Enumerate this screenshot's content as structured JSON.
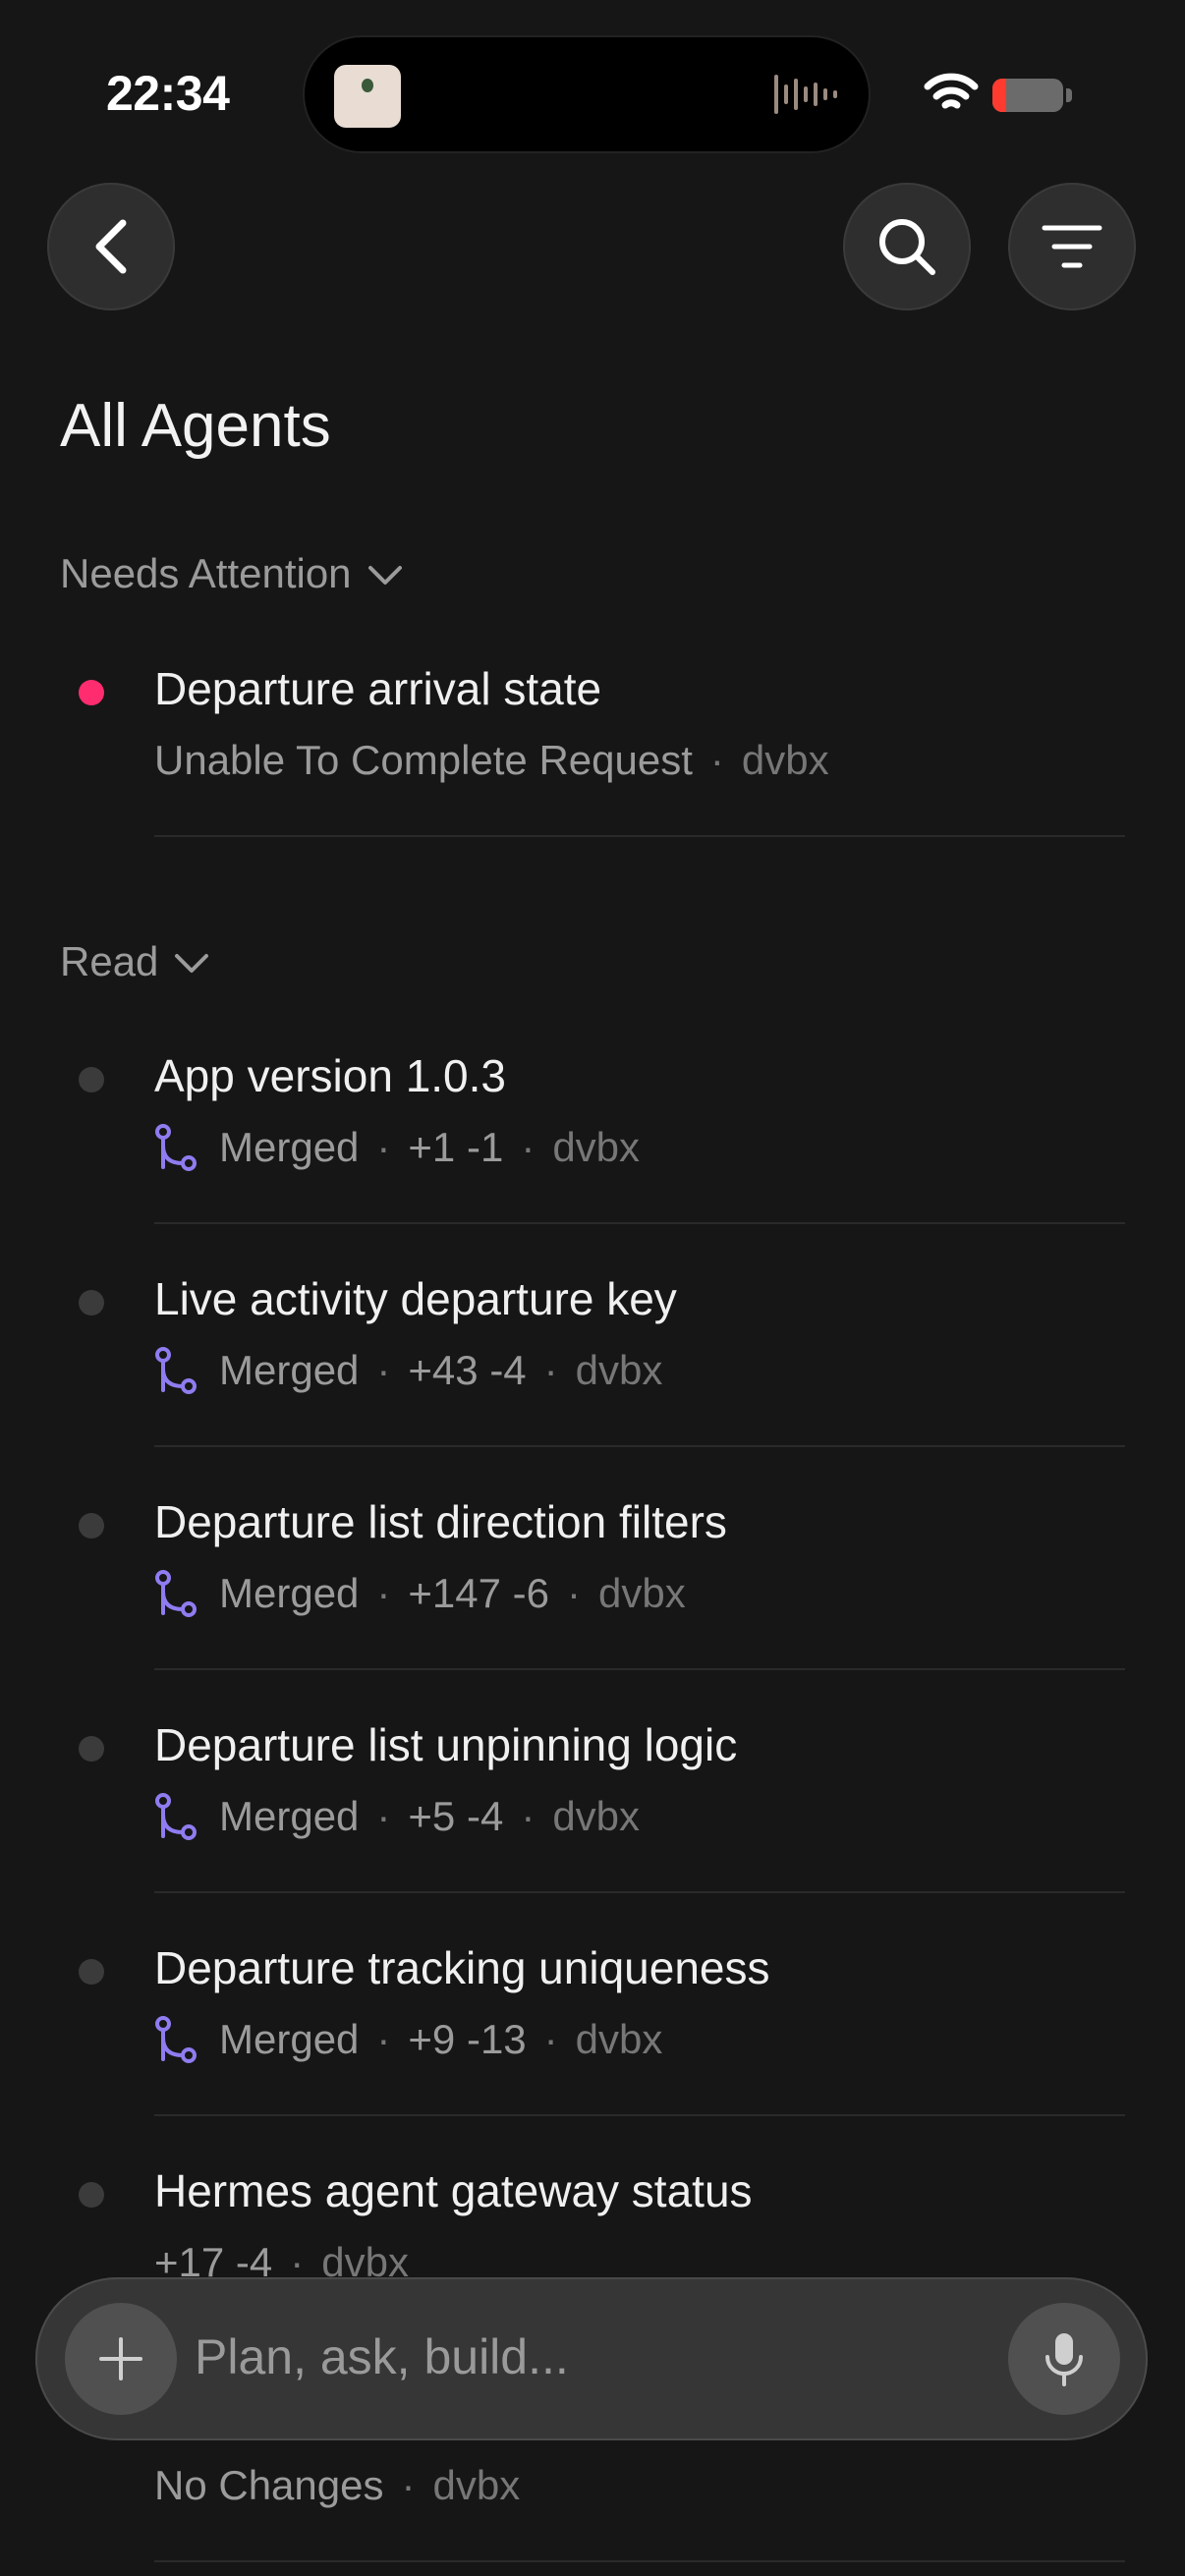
{
  "status_bar": {
    "time": "22:34",
    "battery_level": 0.2
  },
  "page": {
    "title": "All Agents"
  },
  "sections": {
    "attention": {
      "label": "Needs Attention"
    },
    "read": {
      "label": "Read"
    }
  },
  "attention_items": [
    {
      "title": "Departure arrival state",
      "status": "Unable To Complete Request",
      "repo": "dvbx",
      "dot_color": "#ff2d6f"
    }
  ],
  "read_items": [
    {
      "title": "App version 1.0.3",
      "status": "Merged",
      "diff": "+1 -1",
      "repo": "dvbx"
    },
    {
      "title": "Live activity departure key",
      "status": "Merged",
      "diff": "+43 -4",
      "repo": "dvbx"
    },
    {
      "title": "Departure list direction filters",
      "status": "Merged",
      "diff": "+147 -6",
      "repo": "dvbx"
    },
    {
      "title": "Departure list unpinning logic",
      "status": "Merged",
      "diff": "+5 -4",
      "repo": "dvbx"
    },
    {
      "title": "Departure tracking uniqueness",
      "status": "Merged",
      "diff": "+9 -13",
      "repo": "dvbx"
    },
    {
      "title": "Hermes agent gateway status",
      "diff": "+17 -4",
      "repo": "dvbx"
    },
    {
      "status": "No Changes",
      "repo": "dvbx"
    }
  ],
  "composer": {
    "placeholder": "Plan, ask, build..."
  },
  "icons": {
    "merge_color": "#8f7cf0",
    "read_dot_color": "#3b3b3b"
  }
}
